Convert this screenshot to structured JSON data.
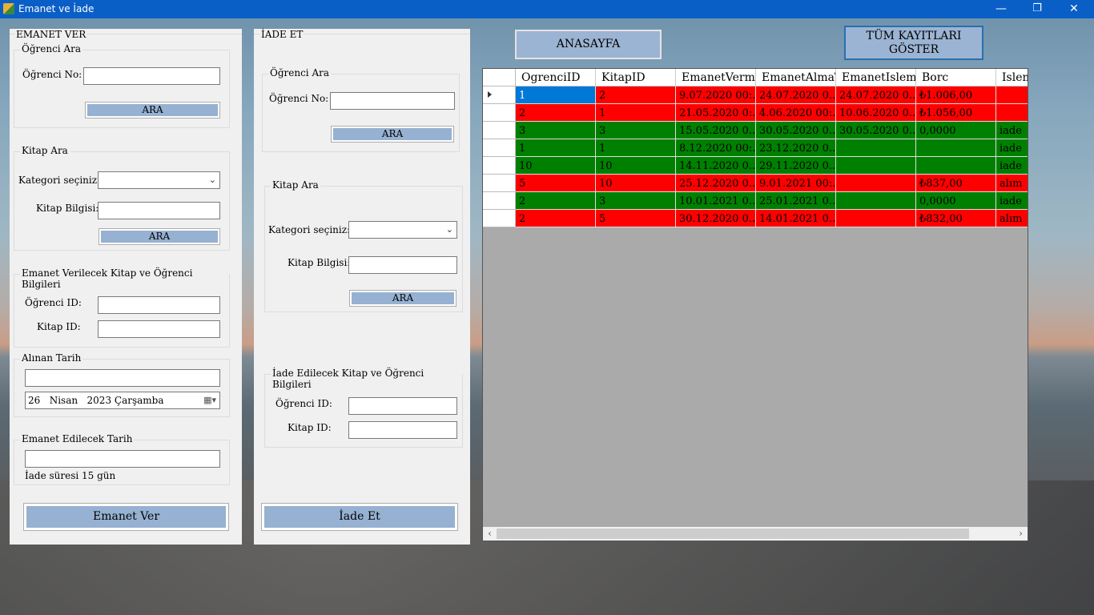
{
  "window": {
    "title": "Emanet ve İade",
    "min": "—",
    "max": "❐",
    "close": "✕"
  },
  "emanet": {
    "header": "EMANET VER",
    "ogrenci_ara": {
      "title": "Öğrenci Ara",
      "no_label": "Öğrenci No:",
      "no_value": "",
      "ara": "ARA"
    },
    "kitap_ara": {
      "title": "Kitap Ara",
      "kategori_label": "Kategori seçiniz:",
      "kategori_value": "",
      "bilgi_label": "Kitap Bilgisi:",
      "bilgi_value": "",
      "ara": "ARA"
    },
    "bilgiler": {
      "title": "Emanet Verilecek Kitap ve Öğrenci Bilgileri",
      "ogrenci_id_label": "Öğrenci ID:",
      "ogrenci_id_value": "",
      "kitap_id_label": "Kitap ID:",
      "kitap_id_value": ""
    },
    "alinan": {
      "title": "Alınan Tarih",
      "text_value": "",
      "date_value": "26   Nisan   2023 Çarşamba"
    },
    "edilecek": {
      "title": "Emanet Edilecek Tarih",
      "text_value": "",
      "note": "İade süresi 15 gün"
    },
    "submit": "Emanet Ver"
  },
  "iade": {
    "header": "İADE ET",
    "ogrenci_ara": {
      "title": "Öğrenci Ara",
      "no_label": "Öğrenci No:",
      "no_value": "",
      "ara": "ARA"
    },
    "kitap_ara": {
      "title": "Kitap Ara",
      "kategori_label": "Kategori seçiniz:",
      "kategori_value": "",
      "bilgi_label": "Kitap Bilgisi:",
      "bilgi_value": "",
      "ara": "ARA"
    },
    "bilgiler": {
      "title": "İade Edilecek Kitap ve Öğrenci Bilgileri",
      "ogrenci_id_label": "Öğrenci ID:",
      "ogrenci_id_value": "",
      "kitap_id_label": "Kitap ID:",
      "kitap_id_value": ""
    },
    "submit": "İade Et"
  },
  "top_buttons": {
    "anasayfa": "ANASAYFA",
    "tum_kayitlar": "TÜM KAYITLARI GÖSTER"
  },
  "grid": {
    "columns": [
      "OgrenciID",
      "KitapID",
      "EmanetVermeT",
      "EmanetAlmaTa",
      "EmanetIslemTa",
      "Borc",
      "Islem"
    ],
    "rows": [
      {
        "status": "red",
        "cells": [
          "1",
          "2",
          "9.07.2020 00:...",
          "24.07.2020 0...",
          "24.07.2020 0...",
          "₺1.006,00",
          ""
        ]
      },
      {
        "status": "red",
        "cells": [
          "2",
          "1",
          "21.05.2020 0:...",
          "4.06.2020 00:...",
          "10.06.2020 0...",
          "₺1.056,00",
          ""
        ]
      },
      {
        "status": "green",
        "cells": [
          "3",
          "3",
          "15.05.2020 0...",
          "30.05.2020 0...",
          "30.05.2020 0...",
          "0,0000",
          "iade"
        ]
      },
      {
        "status": "green",
        "cells": [
          "1",
          "1",
          "8.12.2020 00:...",
          "23.12.2020 0...",
          "",
          "",
          "iade"
        ]
      },
      {
        "status": "green",
        "cells": [
          "10",
          "10",
          "14.11.2020 0...",
          "29.11.2020 0...",
          "",
          "",
          "iade"
        ]
      },
      {
        "status": "red",
        "cells": [
          "5",
          "10",
          "25.12.2020 0...",
          "9.01.2021 00:...",
          "",
          "₺837,00",
          "alım"
        ]
      },
      {
        "status": "green",
        "cells": [
          "2",
          "3",
          "10.01.2021 0...",
          "25.01.2021 0...",
          "",
          "0,0000",
          "iade"
        ]
      },
      {
        "status": "red",
        "cells": [
          "2",
          "5",
          "30.12.2020 0...",
          "14.01.2021 0...",
          "",
          "₺832,00",
          "alım"
        ]
      }
    ],
    "colors": {
      "red": "#ff0000",
      "green": "#008000",
      "selected": "#0078d7"
    }
  }
}
